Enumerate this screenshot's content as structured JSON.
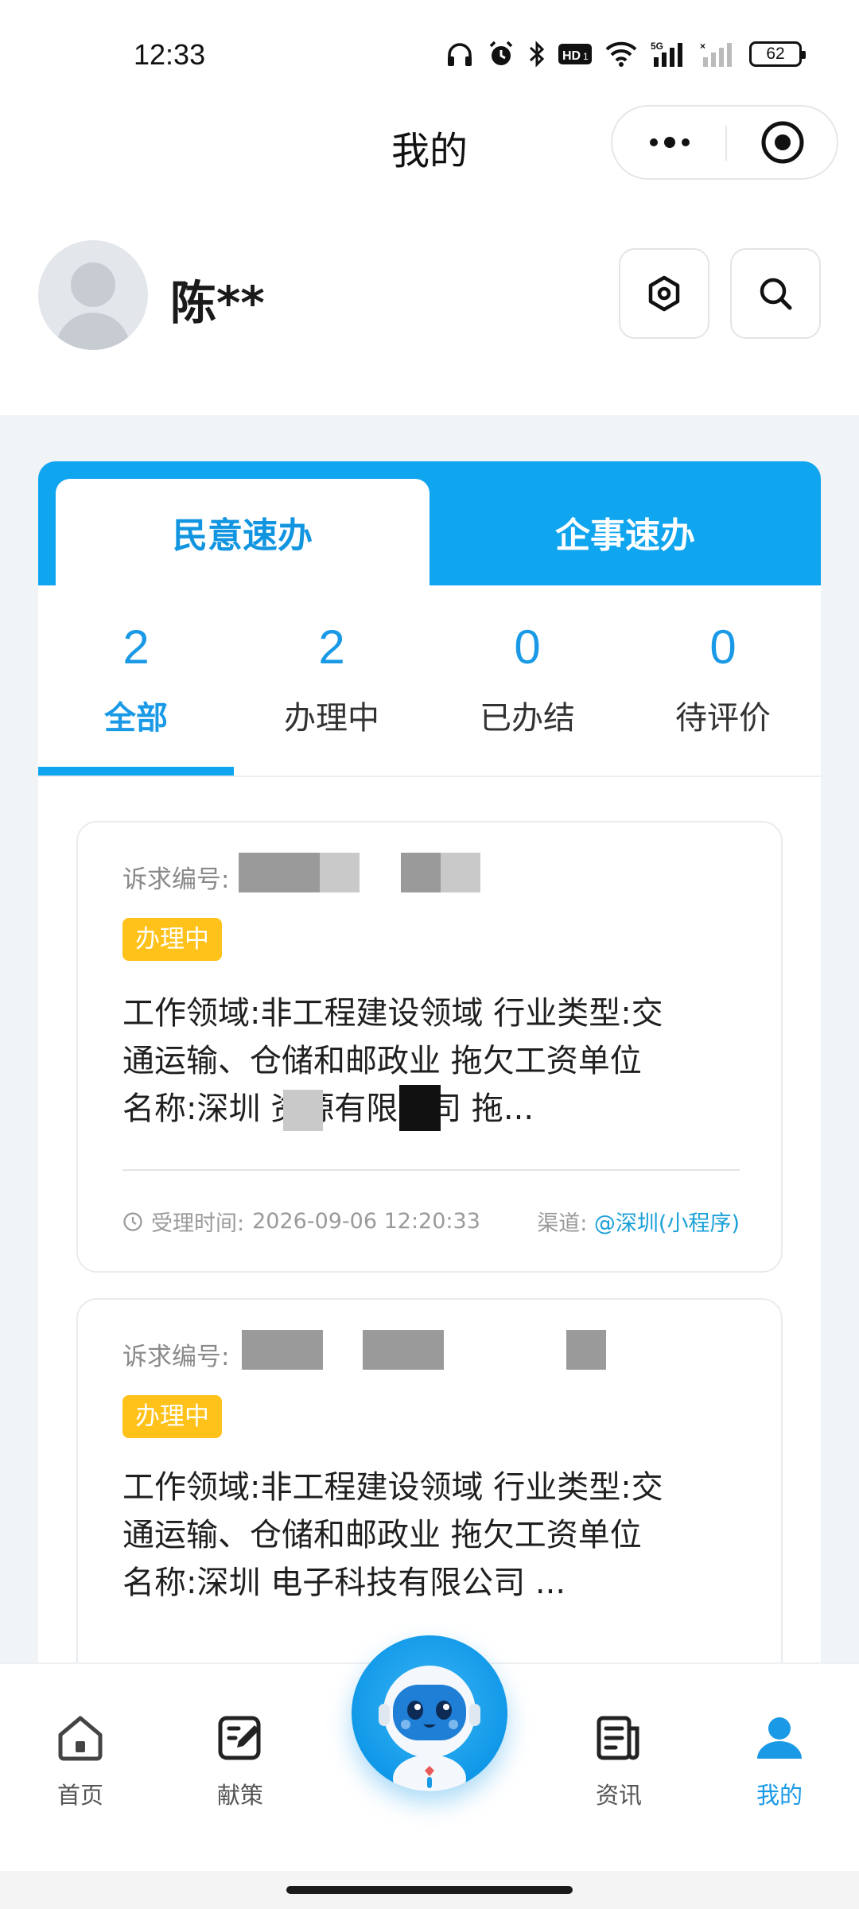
{
  "status_bar": {
    "time": "12:33",
    "battery": "62",
    "network": "5G"
  },
  "header": {
    "title": "我的"
  },
  "profile": {
    "name": "陈**"
  },
  "tabs": [
    {
      "label": "民意速办",
      "active": true
    },
    {
      "label": "企事速办",
      "active": false
    }
  ],
  "stats": [
    {
      "count": "2",
      "label": "全部",
      "active": true
    },
    {
      "count": "2",
      "label": "办理中",
      "active": false
    },
    {
      "count": "0",
      "label": "已办结",
      "active": false
    },
    {
      "count": "0",
      "label": "待评价",
      "active": false
    }
  ],
  "records": [
    {
      "id_label": "诉求编号:",
      "status": "办理中",
      "desc_lines": [
        "工作领域:非工程建设领域 行业类型:交",
        "通运输、仓储和邮政业 拖欠工资单位",
        "名称:深圳      资源有限公司 拖..."
      ],
      "time_label": "受理时间:",
      "time_value": "2026-09-06 12:20:33",
      "channel_label": "渠道:",
      "channel_value": "@深圳(小程序)"
    },
    {
      "id_label": "诉求编号:",
      "status": "办理中",
      "desc_lines": [
        "工作领域:非工程建设领域 行业类型:交",
        "通运输、仓储和邮政业 拖欠工资单位",
        "名称:深圳       电子科技有限公司 ..."
      ]
    }
  ],
  "bottom_nav": [
    {
      "label": "首页",
      "icon": "home-icon",
      "active": false
    },
    {
      "label": "献策",
      "icon": "edit-icon",
      "active": false
    },
    {
      "label": "资讯",
      "icon": "news-icon",
      "active": false
    },
    {
      "label": "我的",
      "icon": "user-icon",
      "active": true
    }
  ],
  "colors": {
    "accent": "#10a5ef",
    "badge": "#ffc21a",
    "background": "#f0f4f7"
  }
}
